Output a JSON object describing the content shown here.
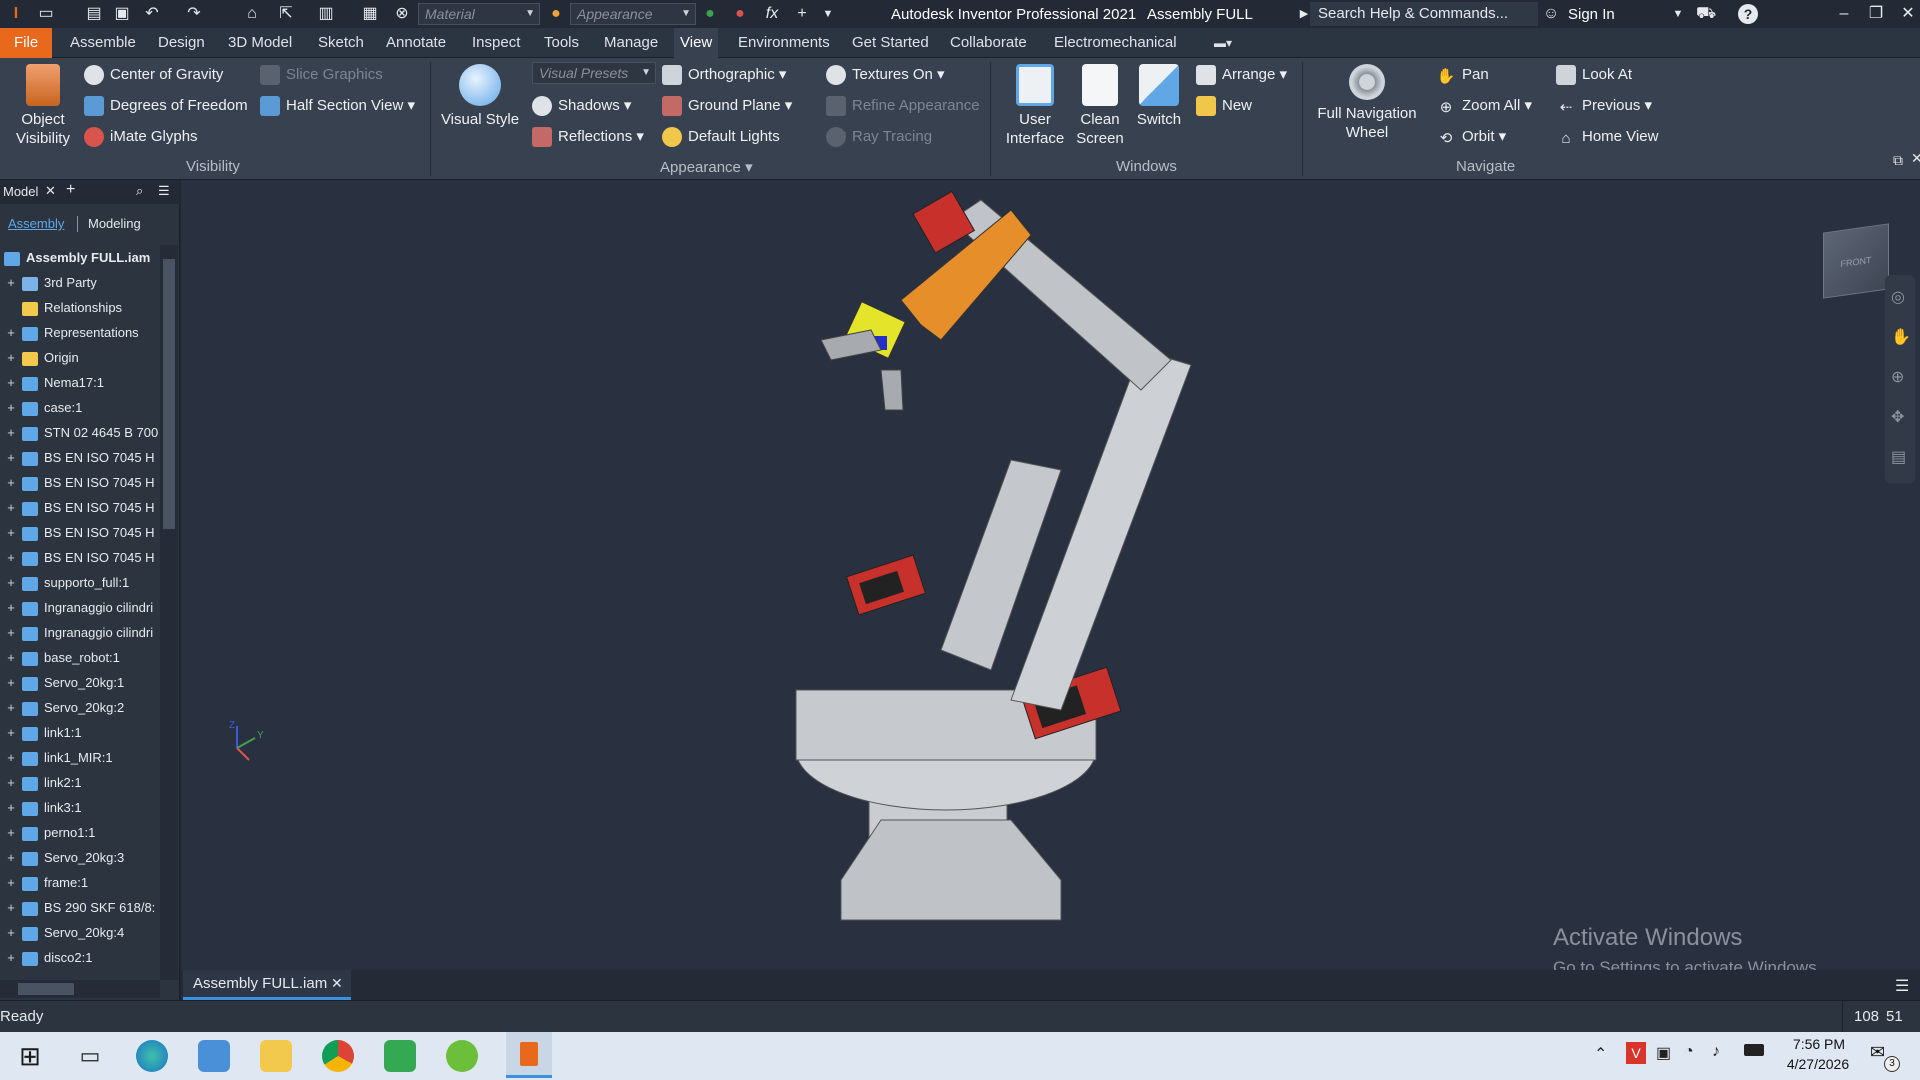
{
  "titlebar": {
    "material_placeholder": "Material",
    "appearance_placeholder": "Appearance",
    "app_title": "Autodesk Inventor Professional 2021",
    "doc_title": "Assembly FULL",
    "search_text": "Search Help & Commands...",
    "sign_in": "Sign In"
  },
  "ribbon_tabs": [
    "File",
    "Assemble",
    "Design",
    "3D Model",
    "Sketch",
    "Annotate",
    "Inspect",
    "Tools",
    "Manage",
    "View",
    "Environments",
    "Get Started",
    "Collaborate",
    "Electromechanical"
  ],
  "ribbon": {
    "object_visibility": "Object Visibility",
    "center_of_gravity": "Center of Gravity",
    "degrees_of_freedom": "Degrees of Freedom",
    "imate_glyphs": "iMate Glyphs",
    "slice_graphics": "Slice Graphics",
    "half_section_view": "Half Section View",
    "visibility_group": "Visibility",
    "visual_style": "Visual Style",
    "visual_presets": "Visual Presets",
    "orthographic": "Orthographic",
    "textures_on": "Textures On",
    "shadows": "Shadows",
    "ground_plane": "Ground Plane",
    "refine_appearance": "Refine Appearance",
    "reflections": "Reflections",
    "default_lights": "Default Lights",
    "ray_tracing": "Ray Tracing",
    "appearance_group": "Appearance",
    "user_interface": "User Interface",
    "clean_screen": "Clean Screen",
    "switch": "Switch",
    "arrange": "Arrange",
    "new": "New",
    "windows_group": "Windows",
    "full_navigation_wheel": "Full Navigation Wheel",
    "pan": "Pan",
    "zoom_all": "Zoom All",
    "orbit": "Orbit",
    "look_at": "Look At",
    "previous": "Previous",
    "home_view": "Home View",
    "navigate_group": "Navigate"
  },
  "browser": {
    "tab_model": "Model",
    "sub_assembly": "Assembly",
    "sub_modeling": "Modeling",
    "root": "Assembly FULL.iam",
    "items": [
      "3rd Party",
      "Relationships",
      "Representations",
      "Origin",
      "Nema17:1",
      "case:1",
      "STN 02 4645 B 700",
      "BS EN ISO 7045 H",
      "BS EN ISO 7045 H",
      "BS EN ISO 7045 H",
      "BS EN ISO 7045 H",
      "BS EN ISO 7045 H",
      "supporto_full:1",
      "Ingranaggio cilindri",
      "Ingranaggio cilindri",
      "base_robot:1",
      "Servo_20kg:1",
      "Servo_20kg:2",
      "link1:1",
      "link1_MIR:1",
      "link2:1",
      "link3:1",
      "perno1:1",
      "Servo_20kg:3",
      "frame:1",
      "BS 290 SKF 618/8:",
      "Servo_20kg:4",
      "disco2:1"
    ]
  },
  "viewport": {
    "viewcube_label": "FRONT",
    "watermark_title": "Activate Windows",
    "watermark_sub": "Go to Settings to activate Windows.",
    "triad_y": "Y",
    "triad_z": "Z"
  },
  "doc_tab": "Assembly FULL.iam",
  "status": {
    "ready": "Ready",
    "count1": "108",
    "count2": "51"
  },
  "taskbar": {
    "time": "7:56 PM",
    "date": "4/27/2026",
    "notifications": "3"
  }
}
